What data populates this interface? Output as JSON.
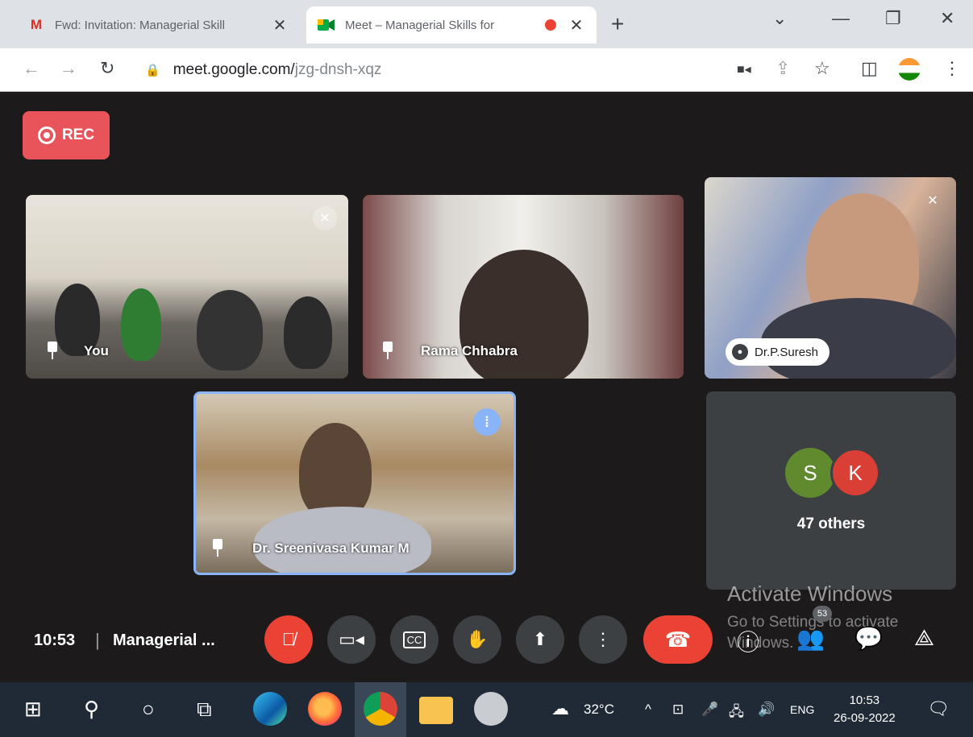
{
  "browser": {
    "tabs": [
      {
        "icon": "gmail-icon",
        "title": "Fwd: Invitation: Managerial Skill"
      },
      {
        "icon": "meet-icon",
        "title": "Meet – Managerial Skills for"
      }
    ],
    "new_tab": "+",
    "address": {
      "host": "meet.google.com/",
      "path": "jzg-dnsh-xqz"
    }
  },
  "meet": {
    "rec_label": "REC",
    "tiles": [
      {
        "name": "You"
      },
      {
        "name": "Rama Chhabra"
      },
      {
        "name": "Dr.P.Suresh"
      },
      {
        "name": "Dr. Sreenivasa Kumar M"
      }
    ],
    "others": {
      "avatars": [
        {
          "letter": "S",
          "color": "#5f8a2e"
        },
        {
          "letter": "K",
          "color": "#d93f35"
        }
      ],
      "label": "47 others"
    },
    "controls": {
      "time": "10:53",
      "separator": "|",
      "meeting_title": "Managerial ...",
      "people_count": "53"
    }
  },
  "watermark": {
    "title": "Activate Windows",
    "sub": "Go to Settings to activate Windows."
  },
  "taskbar": {
    "weather": "32°C",
    "language": "ENG",
    "time": "10:53",
    "date": "26-09-2022"
  }
}
